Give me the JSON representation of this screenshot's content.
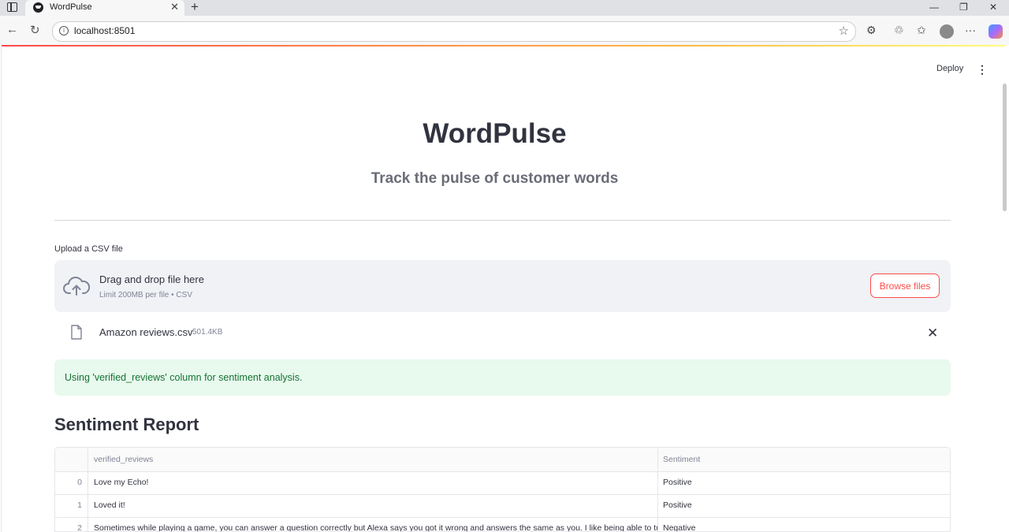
{
  "browser": {
    "tab_title": "WordPulse",
    "url": "localhost:8501",
    "icons": [
      "sidebar-toggle-icon",
      "favicon-icon",
      "tab-close-icon",
      "new-tab-icon",
      "minimize-icon",
      "maximize-icon",
      "window-close-icon",
      "back-icon",
      "refresh-icon",
      "site-info-icon",
      "favorite-star-icon",
      "extensions-icon",
      "browser-essentials-icon",
      "favorites-icon",
      "profile-icon",
      "more-icon",
      "copilot-icon"
    ],
    "new_tab": "+",
    "min": "—",
    "max": "❐",
    "close": "✕",
    "back": "←",
    "refresh": "↻",
    "more": "···"
  },
  "header": {
    "deploy_label": "Deploy",
    "menu_icon": "⋮"
  },
  "app": {
    "title": "WordPulse",
    "subtitle": "Track the pulse of customer words"
  },
  "uploader": {
    "label": "Upload a CSV file",
    "drop_title": "Drag and drop file here",
    "drop_limit": "Limit 200MB per file • CSV",
    "browse_label": "Browse files",
    "file_name": "Amazon reviews.csv",
    "file_size": "501.4KB",
    "remove_icon": "✕"
  },
  "alert": {
    "text": "Using 'verified_reviews' column for sentiment analysis."
  },
  "report": {
    "title": "Sentiment Report",
    "columns": [
      "",
      "verified_reviews",
      "Sentiment"
    ],
    "rows": [
      {
        "index": "0",
        "review": "Love my Echo!",
        "sentiment": "Positive"
      },
      {
        "index": "1",
        "review": "Loved it!",
        "sentiment": "Positive"
      },
      {
        "index": "2",
        "review": "Sometimes while playing a game, you can answer a question correctly but Alexa says you got it wrong and answers the same as you.  I like being able to turn lights on and off while away from home.",
        "sentiment": "Negative"
      }
    ]
  },
  "colors": {
    "accent": "#ff4b4b",
    "success_bg": "#e8f9ee",
    "success_text": "#177233",
    "dropzone_bg": "#f0f2f6"
  }
}
